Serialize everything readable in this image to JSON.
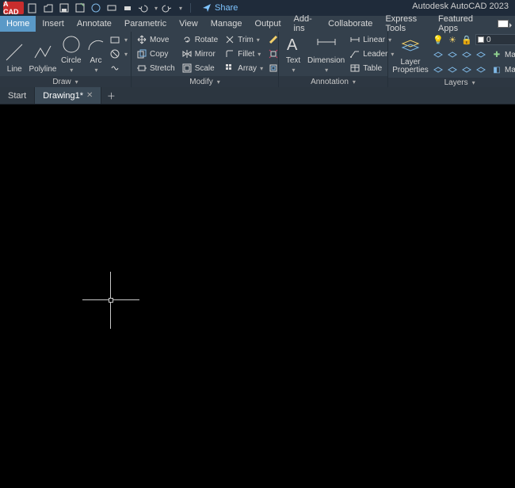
{
  "app": {
    "title": "Autodesk AutoCAD 2023",
    "logo": "A CAD",
    "share": "Share"
  },
  "menu": {
    "tabs": [
      "Home",
      "Insert",
      "Annotate",
      "Parametric",
      "View",
      "Manage",
      "Output",
      "Add-ins",
      "Collaborate",
      "Express Tools",
      "Featured Apps"
    ],
    "active": 0
  },
  "ribbon": {
    "draw": {
      "label": "Draw",
      "line": "Line",
      "polyline": "Polyline",
      "circle": "Circle",
      "arc": "Arc"
    },
    "modify": {
      "label": "Modify",
      "move": "Move",
      "copy": "Copy",
      "stretch": "Stretch",
      "rotate": "Rotate",
      "mirror": "Mirror",
      "scale": "Scale",
      "trim": "Trim",
      "fillet": "Fillet",
      "array": "Array"
    },
    "annotation": {
      "label": "Annotation",
      "text": "Text",
      "dimension": "Dimension",
      "linear": "Linear",
      "leader": "Leader",
      "table": "Table"
    },
    "layers": {
      "label": "Layers",
      "props": "Layer\nProperties",
      "current": "0",
      "make": "Make",
      "match": "Match"
    }
  },
  "docs": {
    "start": "Start",
    "drawing": "Drawing1*"
  }
}
